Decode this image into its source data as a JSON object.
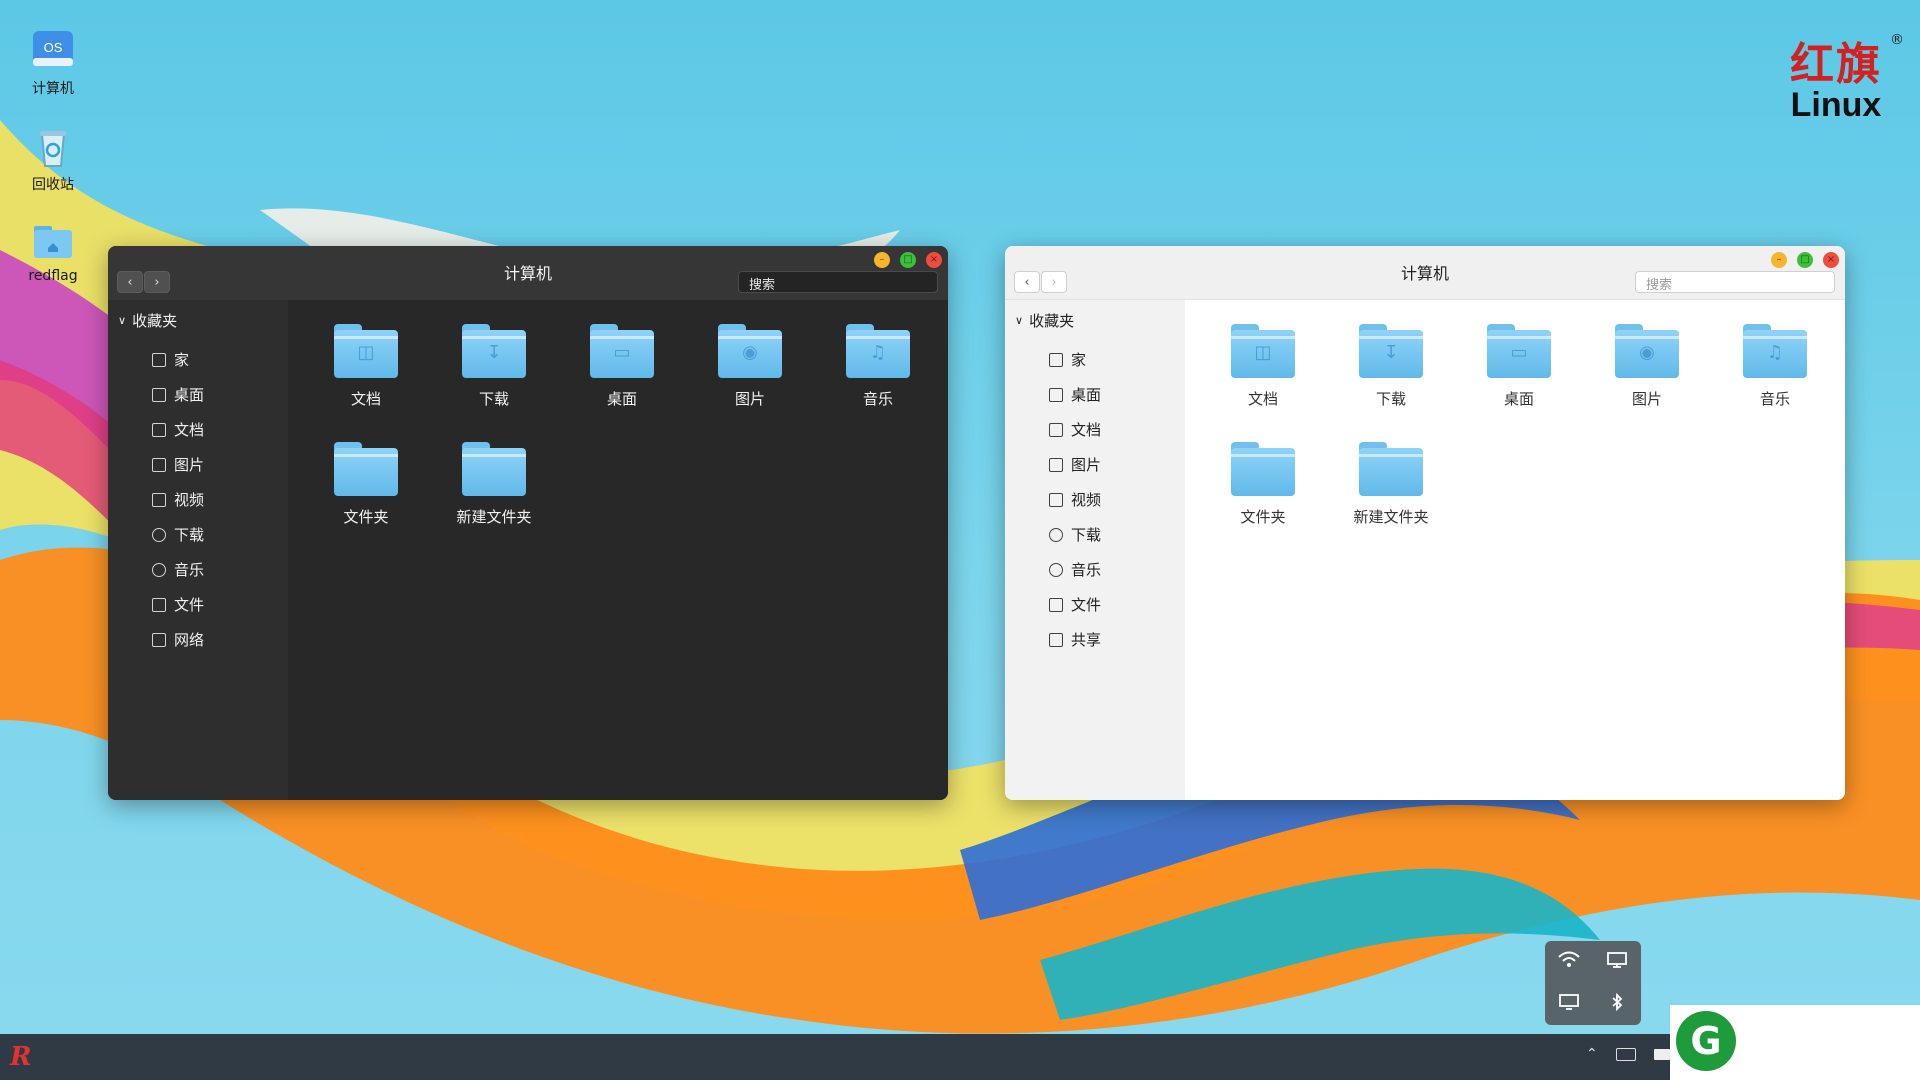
{
  "desktop": {
    "icons": [
      {
        "label": "计算机",
        "icon": "computer-os-icon",
        "badge": "OS"
      },
      {
        "label": "回收站",
        "icon": "recycle-bin-icon"
      },
      {
        "label": "redflag",
        "icon": "home-folder-icon"
      }
    ]
  },
  "brand": {
    "cn": "红旗",
    "en": "Linux",
    "reg": "®"
  },
  "window_dark": {
    "title": "计算机",
    "search_placeholder": "搜索",
    "sidebar_header": "收藏夹",
    "sidebar": [
      "家",
      "桌面",
      "文档",
      "图片",
      "视频",
      "下载",
      "音乐",
      "文件",
      "网络"
    ],
    "folders": [
      "文档",
      "下载",
      "桌面",
      "图片",
      "音乐",
      "文件夹",
      "新建文件夹"
    ]
  },
  "window_light": {
    "title": "计算机",
    "search_placeholder": "搜索",
    "sidebar_header": "收藏夹",
    "sidebar": [
      "家",
      "桌面",
      "文档",
      "图片",
      "视频",
      "下载",
      "音乐",
      "文件",
      "共享"
    ],
    "folders": [
      "文档",
      "下载",
      "桌面",
      "图片",
      "音乐",
      "文件夹",
      "新建文件夹"
    ]
  },
  "tray_popup": [
    "wifi-icon",
    "monitor-icon",
    "display-icon",
    "bluetooth-icon"
  ],
  "taskbar": {
    "start_label": "R",
    "tray": [
      "chevron-up-icon",
      "keyboard-icon",
      "battery-icon"
    ]
  },
  "corner_logo": {
    "mark": "G"
  },
  "colors": {
    "accent_red": "#d32020",
    "folder_blue": "#6fc0ec",
    "dark_window": "#2b2b2b",
    "light_window": "#ffffff",
    "taskbar": "#2f3a44"
  }
}
